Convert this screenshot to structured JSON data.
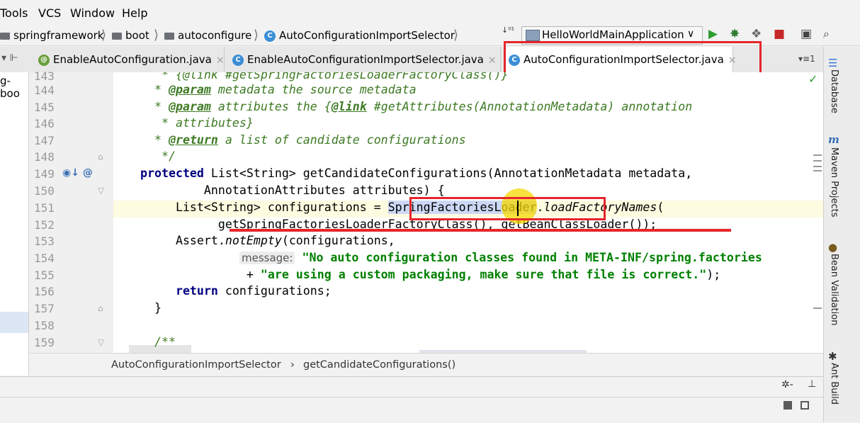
{
  "menu": [
    "Tools",
    "VCS",
    "Window",
    "Help"
  ],
  "breadcrumbs": {
    "items": [
      "springframework",
      "boot",
      "autoconfigure",
      "AutoConfigurationImportSelector"
    ],
    "class_icon": "C"
  },
  "run_config": {
    "label": "HelloWorldMainApplication",
    "arrow": "∨"
  },
  "toolbar_icons": {
    "run": "▶",
    "debug": "✸",
    "coverage": "❖",
    "stop": "■",
    "structure": "▣",
    "search": "🔍",
    "sort": "↓⁰¹"
  },
  "tabs": [
    {
      "label": "EnableAutoConfiguration.java",
      "icon": "@"
    },
    {
      "label": "EnableAutoConfigurationImportSelector.java",
      "icon": "C"
    },
    {
      "label": "AutoConfigurationImportSelector.java",
      "icon": "C"
    }
  ],
  "tab_close": "×",
  "tab_overflow": "▾≡1",
  "project_strip_text": "g-boo",
  "line_numbers": [
    "143",
    "144",
    "145",
    "146",
    "147",
    "148",
    "149",
    "150",
    "151",
    "152",
    "153",
    "154",
    "155",
    "156",
    "157",
    "158",
    "159"
  ],
  "gutter_149_icons": "◉↓ @",
  "code": {
    "l143": "   * {@link #getSpringFactoriesLoaderFactoryClass()}",
    "l144_tag": "@param",
    "l144_rest": " metadata the source metadata",
    "l145_tag": "@param",
    "l145_mid": " attributes the {",
    "l145_link": "@link",
    "l145_rest": " #getAttributes(AnnotationMetadata) annotation",
    "l146": "   * attributes}",
    "l147_tag": "@return",
    "l147_rest": " a list of candidate configurations",
    "l148": "   */",
    "l149_kw": "protected",
    "l149_rest": " List<String> getCandidateConfigurations(AnnotationMetadata metadata,",
    "l150": "         AnnotationAttributes attributes) {",
    "l151_a": "     List<String> configurations = ",
    "l151_sel": "SpringFactoriesLoader",
    "l151_b": ".",
    "l151_method": "loadFactoryNames",
    "l151_c": "(",
    "l152": "           getSpringFactoriesLoaderFactoryClass(), getBeanClassLoader());",
    "l153_a": "     Assert.",
    "l153_method": "notEmpty",
    "l153_b": "(configurations,",
    "l154_hint": "message:",
    "l154_str": " \"No auto configuration classes found in META-INF/spring.factories",
    "l155_plus": "               + ",
    "l155_str": "\"are using a custom packaging, make sure that file is correct.\"",
    "l155_end": ");",
    "l156_kw": "return",
    "l156_rest": " configurations;",
    "l157": "  }",
    "l159": "  /**"
  },
  "editor_breadcrumb": {
    "class": "AutoConfigurationImportSelector",
    "sep": "›",
    "method": "getCandidateConfigurations()"
  },
  "right_tools": [
    "Database",
    "Maven Projects",
    "Bean Validation",
    "Ant Build"
  ],
  "right_icon_maven": "m",
  "checkmark": "✓",
  "bottom_icons": {
    "settings": "✲-",
    "minimize": "⊥"
  },
  "colors": {
    "highlight_red": "#e5262b",
    "cursor_yellow": "#f5d800",
    "keyword": "#000080",
    "string": "#008000",
    "doc": "#3d7a23"
  }
}
